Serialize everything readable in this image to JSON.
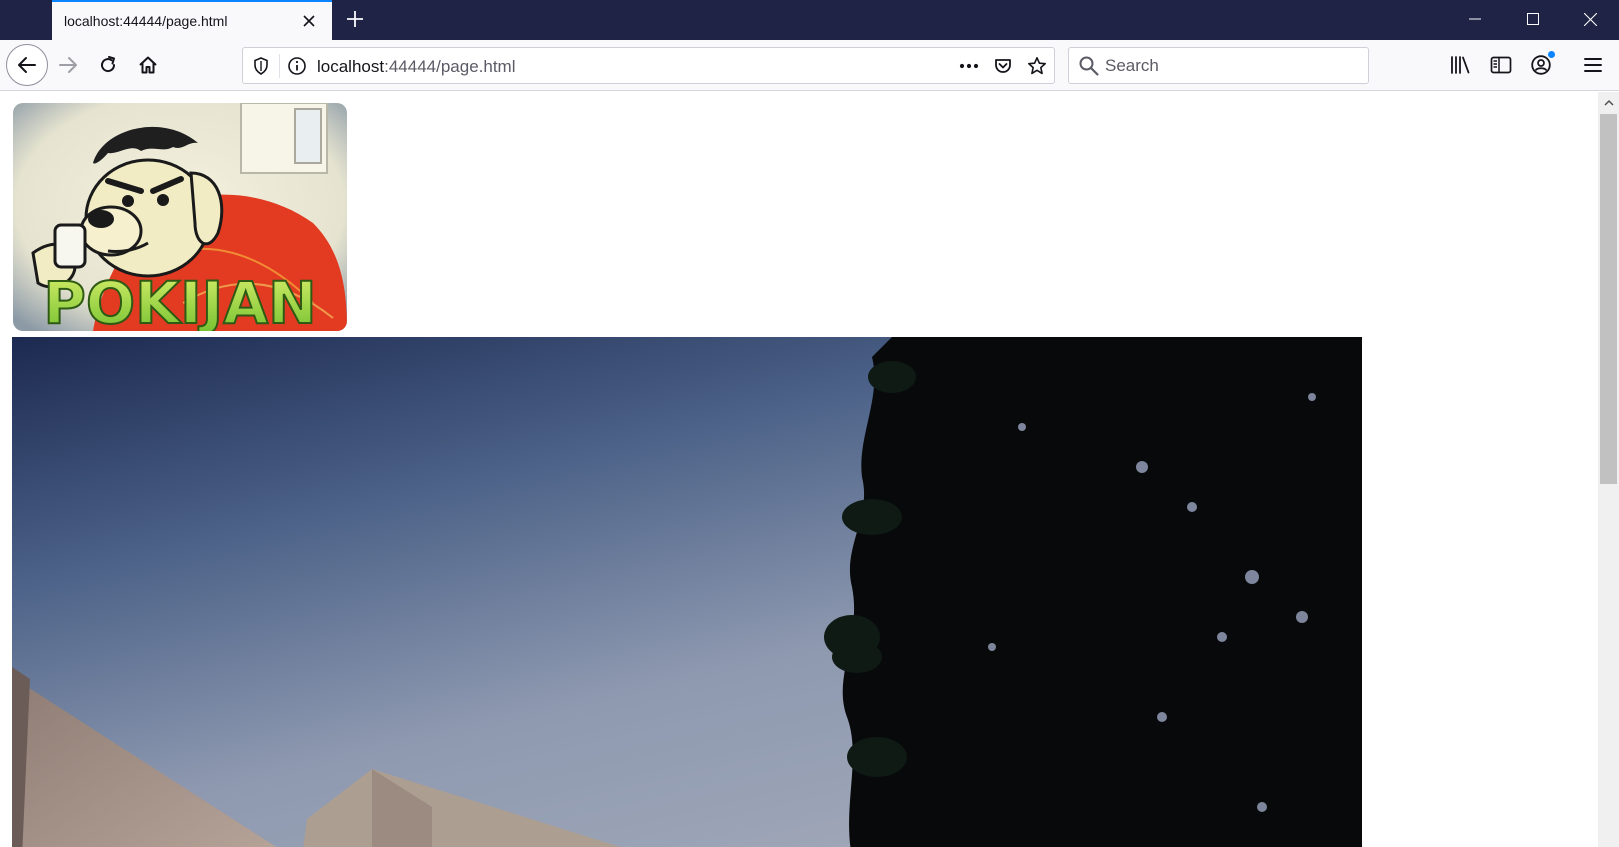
{
  "tab": {
    "title": "localhost:44444/page.html"
  },
  "urlbar": {
    "host": "localhost",
    "rest": ":44444/page.html"
  },
  "search": {
    "placeholder": "Search"
  },
  "content": {
    "logo_text": "POKIJAN"
  },
  "colors": {
    "titlebar": "#1f2346",
    "tab_accent": "#0a84ff",
    "toolbar": "#f9f9fb",
    "badge": "#0a84ff"
  },
  "icons": {
    "tab_close": "close-icon",
    "new_tab": "plus-icon",
    "back": "arrow-left-icon",
    "forward": "arrow-right-icon",
    "reload": "reload-icon",
    "home": "home-icon",
    "shield": "shield-icon",
    "info": "info-icon",
    "more": "ellipsis-icon",
    "pocket": "pocket-icon",
    "bookmark": "star-icon",
    "library": "library-icon",
    "sidebar": "sidebar-icon",
    "account": "account-icon",
    "menu": "hamburger-icon"
  }
}
